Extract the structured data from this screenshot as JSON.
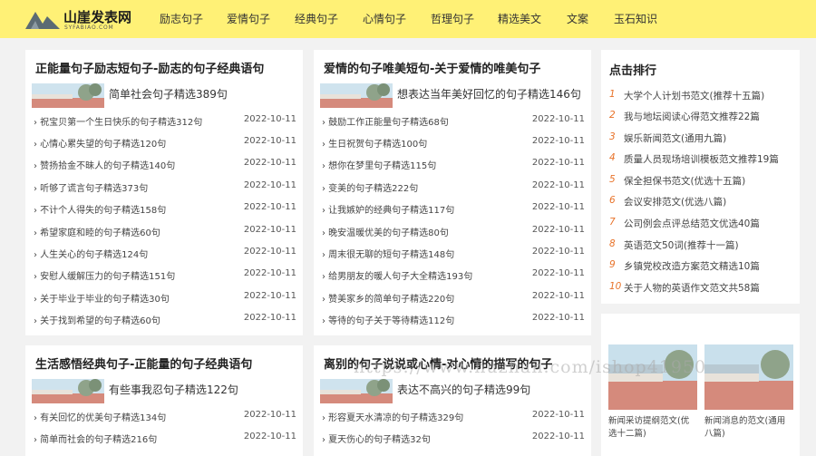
{
  "site": {
    "name": "山崖发表网",
    "sub": "SYFABIAO.COM"
  },
  "nav": [
    "励志句子",
    "爱情句子",
    "经典句子",
    "心情句子",
    "哲理句子",
    "精选美文",
    "文案",
    "玉石知识"
  ],
  "sections": [
    {
      "title": "正能量句子励志短句子-励志的句子经典语句",
      "featured": "简单社会句子精选389句",
      "items": [
        {
          "title": "祝宝贝第一个生日快乐的句子精选312句",
          "date": "2022-10-11"
        },
        {
          "title": "心情心累失望的句子精选120句",
          "date": "2022-10-11"
        },
        {
          "title": "赞扬拾金不昧人的句子精选140句",
          "date": "2022-10-11"
        },
        {
          "title": "听够了谎言句子精选373句",
          "date": "2022-10-11"
        },
        {
          "title": "不计个人得失的句子精选158句",
          "date": "2022-10-11"
        },
        {
          "title": "希望家庭和睦的句子精选60句",
          "date": "2022-10-11"
        },
        {
          "title": "人生关心的句子精选124句",
          "date": "2022-10-11"
        },
        {
          "title": "安慰人缓解压力的句子精选151句",
          "date": "2022-10-11"
        },
        {
          "title": "关于毕业于毕业的句子精选30句",
          "date": "2022-10-11"
        },
        {
          "title": "关于找到希望的句子精选60句",
          "date": "2022-10-11"
        }
      ]
    },
    {
      "title": "爱情的句子唯美短句-关于爱情的唯美句子",
      "featured": "想表达当年美好回忆的句子精选146句",
      "items": [
        {
          "title": "鼓励工作正能量句子精选68句",
          "date": "2022-10-11"
        },
        {
          "title": "生日祝贺句子精选100句",
          "date": "2022-10-11"
        },
        {
          "title": "想你在梦里句子精选115句",
          "date": "2022-10-11"
        },
        {
          "title": "变美的句子精选222句",
          "date": "2022-10-11"
        },
        {
          "title": "让我嫉妒的经典句子精选117句",
          "date": "2022-10-11"
        },
        {
          "title": "晚安温暖优美的句子精选80句",
          "date": "2022-10-11"
        },
        {
          "title": "周末很无聊的短句子精选148句",
          "date": "2022-10-11"
        },
        {
          "title": "给男朋友的暖人句子大全精选193句",
          "date": "2022-10-11"
        },
        {
          "title": "赞美家乡的简单句子精选220句",
          "date": "2022-10-11"
        },
        {
          "title": "等待的句子关于等待精选112句",
          "date": "2022-10-11"
        }
      ]
    },
    {
      "title": "生活感悟经典句子-正能量的句子经典语句",
      "featured": "有些事我忍句子精选122句",
      "items": [
        {
          "title": "有关回忆的优美句子精选134句",
          "date": "2022-10-11"
        },
        {
          "title": "简单而社会的句子精选216句",
          "date": "2022-10-11"
        }
      ]
    },
    {
      "title": "离别的句子说说或心情-对心情的描写的句子",
      "featured": "表达不高兴的句子精选99句",
      "items": [
        {
          "title": "形容夏天水清凉的句子精选329句",
          "date": "2022-10-11"
        },
        {
          "title": "夏天伤心的句子精选32句",
          "date": "2022-10-11"
        }
      ]
    }
  ],
  "ranking": {
    "title": "点击排行",
    "items": [
      {
        "n": "1",
        "title": "大学个人计划书范文(推荐十五篇)"
      },
      {
        "n": "2",
        "title": "我与地坛阅读心得范文推荐22篇"
      },
      {
        "n": "3",
        "title": "娱乐新闻范文(通用九篇)"
      },
      {
        "n": "4",
        "title": "质量人员现场培训模板范文推荐19篇"
      },
      {
        "n": "5",
        "title": "保全担保书范文(优选十五篇)"
      },
      {
        "n": "6",
        "title": "会议安排范文(优选八篇)"
      },
      {
        "n": "7",
        "title": "公司例会点评总结范文优选40篇"
      },
      {
        "n": "8",
        "title": "英语范文50词(推荐十一篇)"
      },
      {
        "n": "9",
        "title": "乡镇党校改造方案范文精选10篇"
      },
      {
        "n": "10",
        "title": "关于人物的英语作文范文共58篇"
      }
    ]
  },
  "pictures": [
    {
      "caption": "新闻采访提纲范文(优选十二篇)"
    },
    {
      "caption": "新闻消息的范文(通用八篇)"
    }
  ],
  "watermark": "https://www.huzhan.com/ishop41950",
  "colors": {
    "topbar": "#fff176",
    "rank_number": "#e8732a",
    "background": "#f2f2f2"
  }
}
